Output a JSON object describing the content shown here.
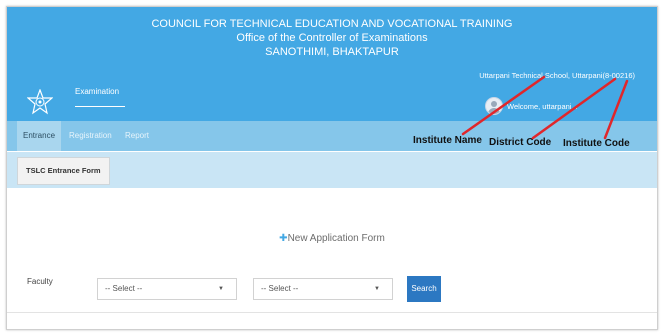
{
  "header": {
    "title_line1": "COUNCIL FOR TECHNICAL EDUCATION AND VOCATIONAL TRAINING",
    "title_line2": "Office of the Controller of Examinations",
    "title_line3": "SANOTHIMI, BHAKTAPUR",
    "section_label": "Examination",
    "school_name": "Uttarpani Technical School, Uttarpani(8-00216)",
    "welcome_text": "Welcome, uttarpani..."
  },
  "nav": {
    "items": [
      {
        "label": "Entrance"
      },
      {
        "label": "Registration"
      },
      {
        "label": "Report"
      }
    ]
  },
  "annotations": {
    "institute_name": "Institute Name",
    "district_code": "District Code",
    "institute_code": "Institute Code",
    "arrow_color": "#e0262b"
  },
  "subtab": {
    "label": "TSLC Entrance Form"
  },
  "form": {
    "title": "New Application Form",
    "faculty_label": "Faculty",
    "select1_value": "-- Select --",
    "select2_value": "-- Select --",
    "search_label": "Search"
  },
  "colors": {
    "header_bg": "#43a8e4",
    "nav_bg": "#85c6ea",
    "subbar_bg": "#c9e5f5",
    "button_bg": "#2c78c2"
  }
}
